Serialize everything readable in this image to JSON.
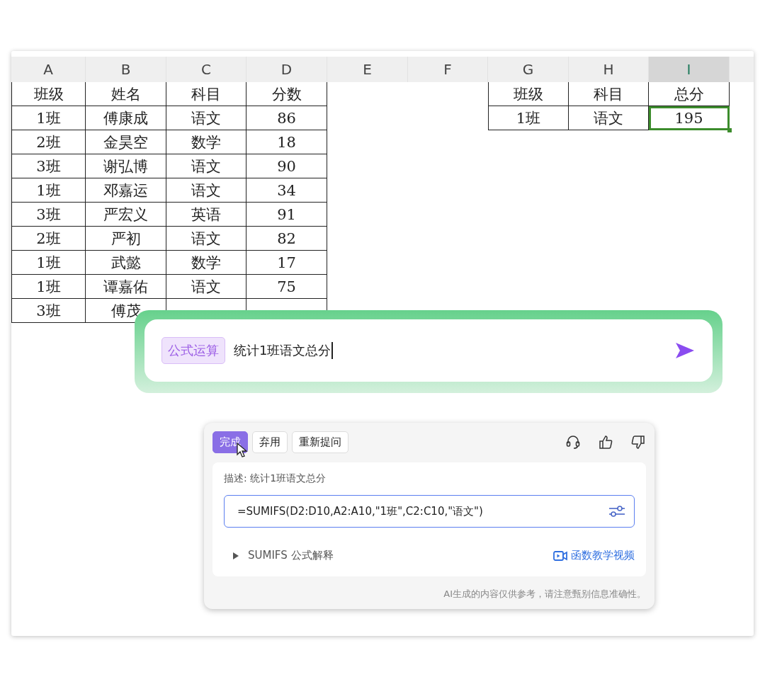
{
  "sheet": {
    "columns": [
      {
        "label": "A",
        "selected": false
      },
      {
        "label": "B",
        "selected": false
      },
      {
        "label": "C",
        "selected": false
      },
      {
        "label": "D",
        "selected": false
      },
      {
        "label": "E",
        "selected": false
      },
      {
        "label": "F",
        "selected": false
      },
      {
        "label": "G",
        "selected": false
      },
      {
        "label": "H",
        "selected": false
      },
      {
        "label": "I",
        "selected": true
      }
    ],
    "left_table": {
      "rows": [
        [
          "班级",
          "姓名",
          "科目",
          "分数"
        ],
        [
          "1班",
          "傅康成",
          "语文",
          "86"
        ],
        [
          "2班",
          "金昊空",
          "数学",
          "18"
        ],
        [
          "3班",
          "谢弘博",
          "语文",
          "90"
        ],
        [
          "1班",
          "邓嘉运",
          "语文",
          "34"
        ],
        [
          "3班",
          "严宏义",
          "英语",
          "91"
        ],
        [
          "2班",
          "严初",
          "语文",
          "82"
        ],
        [
          "1班",
          "武懿",
          "数学",
          "17"
        ],
        [
          "1班",
          "谭嘉佑",
          "语文",
          "75"
        ],
        [
          "3班",
          "傅茂"
        ]
      ]
    },
    "right_table": {
      "rows": [
        [
          {
            "text": "班级",
            "selected": false
          },
          {
            "text": "科目",
            "selected": false
          },
          {
            "text": "总分",
            "selected": false
          }
        ],
        [
          {
            "text": "1班",
            "selected": false
          },
          {
            "text": "语文",
            "selected": false
          },
          {
            "text": "195",
            "selected": true
          }
        ]
      ]
    }
  },
  "prompt": {
    "tag": "公式运算",
    "value": "统计1班语文总分"
  },
  "result": {
    "buttons": [
      {
        "label": "完成",
        "kind": "primary"
      },
      {
        "label": "弃用",
        "kind": "secondary"
      },
      {
        "label": "重新提问",
        "kind": "secondary"
      }
    ],
    "description": "描述: 统计1班语文总分",
    "formula": "=SUMIFS(D2:D10,A2:A10,\"1班\",C2:C10,\"语文\")",
    "explain": "SUMIFS 公式解释",
    "video_link": "函数教学视频",
    "disclaimer": "AI生成的内容仅供参考，请注意甄别信息准确性。"
  }
}
